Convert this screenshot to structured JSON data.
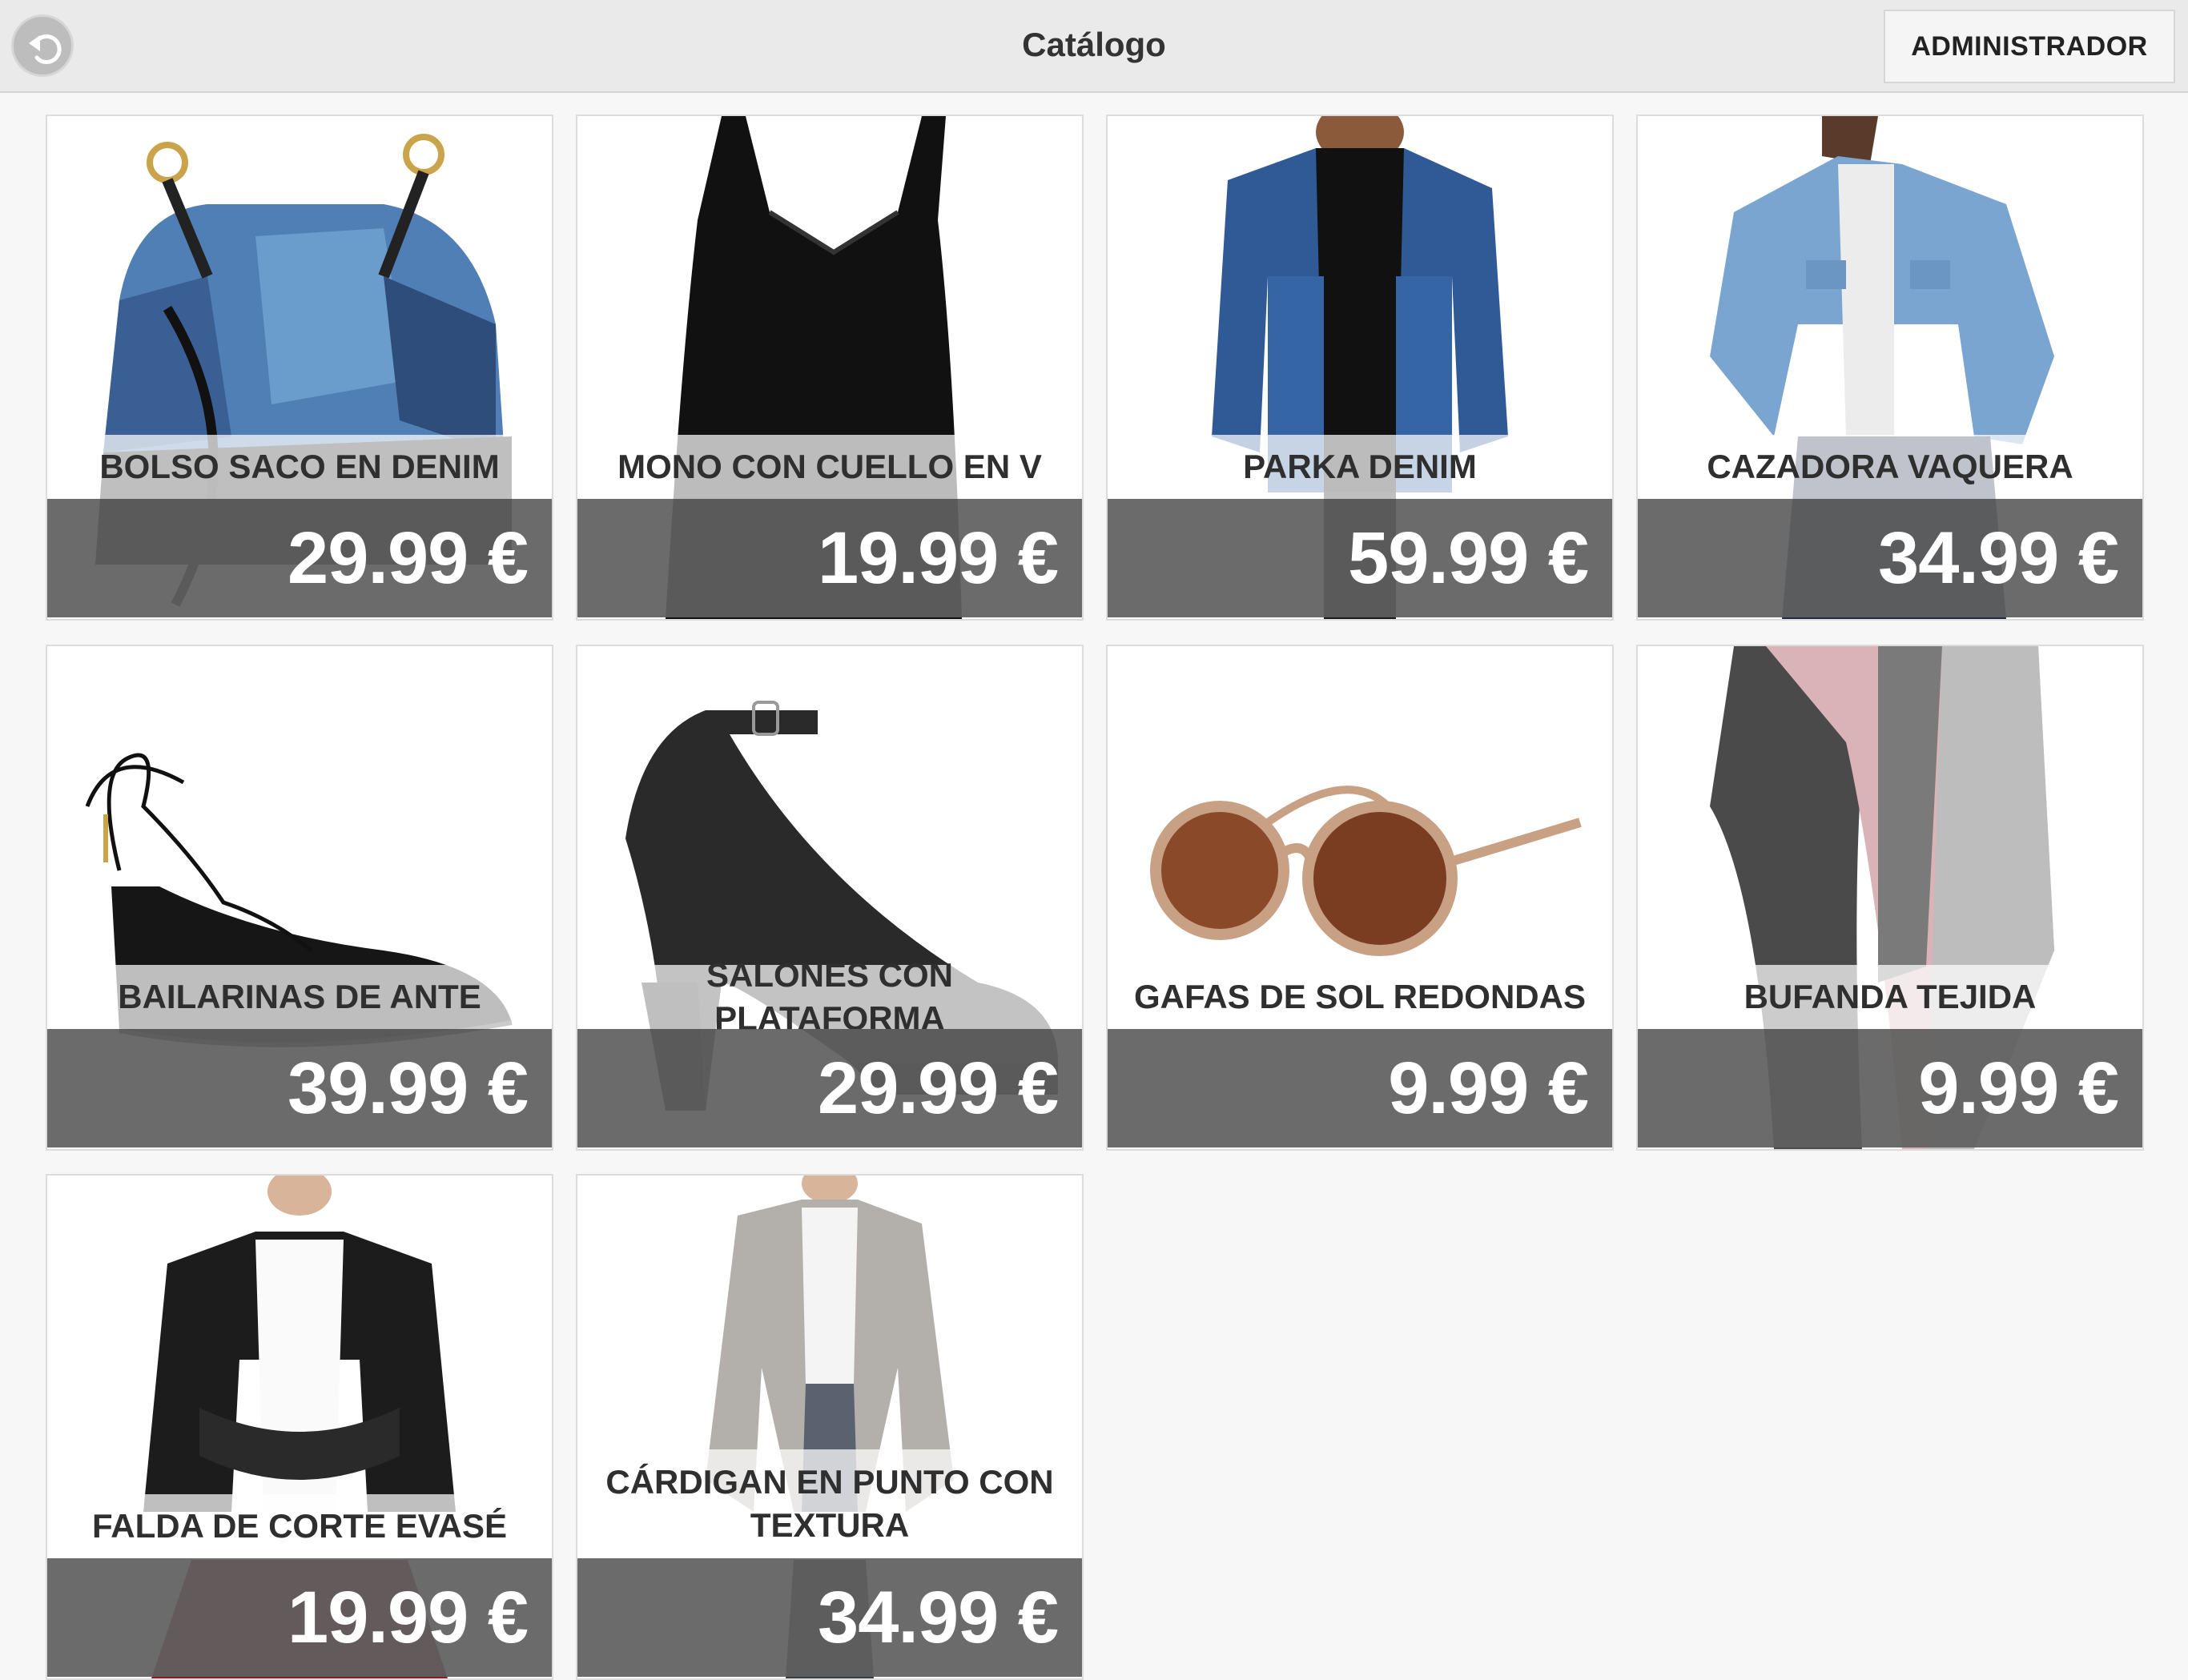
{
  "header": {
    "title": "Catálogo",
    "admin_label": "ADMINISTRADOR",
    "back_icon": "undo-arrow-icon"
  },
  "products": [
    {
      "name": "BOLSO SACO EN DENIM",
      "price": "29.99 €"
    },
    {
      "name": "MONO CON CUELLO EN V",
      "price": "19.99 €"
    },
    {
      "name": "PARKA DENIM",
      "price": "59.99 €"
    },
    {
      "name": "CAZADORA VAQUERA",
      "price": "34.99 €"
    },
    {
      "name": "BAILARINAS DE ANTE",
      "price": "39.99 €"
    },
    {
      "name": "SALONES CON PLATAFORMA",
      "price": "29.99 €"
    },
    {
      "name": "GAFAS DE SOL REDONDAS",
      "price": "9.99 €"
    },
    {
      "name": "BUFANDA TEJIDA",
      "price": "9.99 €"
    },
    {
      "name": "FALDA DE CORTE EVASÉ",
      "price": "19.99 €"
    },
    {
      "name": "CÁRDIGAN EN PUNTO CON TEXTURA",
      "price": "34.99 €"
    }
  ],
  "colors": {
    "header_bg": "#eaeaea",
    "price_band": "#606060",
    "page_bg": "#f7f7f7"
  }
}
